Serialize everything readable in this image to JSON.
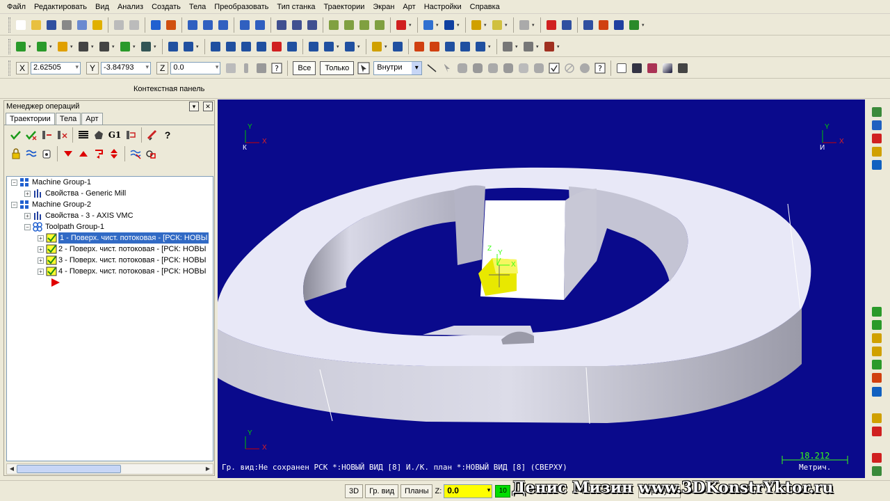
{
  "menu": [
    "Файл",
    "Редактировать",
    "Вид",
    "Анализ",
    "Создать",
    "Тела",
    "Преобразовать",
    "Тип станка",
    "Траектории",
    "Экран",
    "Арт",
    "Настройки",
    "Справка"
  ],
  "coords": {
    "x_label": "X",
    "x_value": "2.62505",
    "y_label": "Y",
    "y_value": "-3.84793",
    "z_label": "Z",
    "z_value": "0.0"
  },
  "selection": {
    "all_label": "Все",
    "only_label": "Только",
    "mode_value": "Внутри"
  },
  "context_panel_label": "Контекстная панель",
  "ops_manager": {
    "title": "Менеджер операций",
    "tabs": [
      "Траектории",
      "Тела",
      "Арт"
    ],
    "toolbar_text_g1": "G1",
    "tree": [
      {
        "text": "Machine Group-1",
        "level": 0,
        "icon": "machine-group-icon",
        "expander": "−"
      },
      {
        "text": "Свойства - Generic Mill",
        "level": 1,
        "icon": "properties-icon",
        "expander": "+"
      },
      {
        "text": "Machine Group-2",
        "level": 0,
        "icon": "machine-group-icon",
        "expander": "−"
      },
      {
        "text": "Свойства - 3 - AXIS VMC",
        "level": 1,
        "icon": "properties-icon",
        "expander": "+"
      },
      {
        "text": "Toolpath Group-1",
        "level": 1,
        "icon": "toolpath-group-icon",
        "expander": "−"
      },
      {
        "text": "1 - Поверх. чист. потоковая - [РСК: НОВЫ",
        "level": 2,
        "icon": "operation-check-icon",
        "expander": "+",
        "selected": true
      },
      {
        "text": "2 - Поверх. чист. потоковая - [РСК: НОВЫ",
        "level": 2,
        "icon": "operation-check-icon",
        "expander": "+"
      },
      {
        "text": "3 - Поверх. чист. потоковая - [РСК: НОВЫ",
        "level": 2,
        "icon": "operation-check-icon",
        "expander": "+"
      },
      {
        "text": "4 - Поверх. чист. потоковая - [РСК: НОВЫ",
        "level": 2,
        "icon": "operation-check-icon",
        "expander": "+"
      }
    ]
  },
  "viewport": {
    "background": "#0a0a8c",
    "status_text": "Гр. вид:Не сохранен  РСК *:НОВЫЙ ВИД [8]  И./К. план *:НОВЫЙ ВИД [8] (СВЕРХУ)",
    "scale_value": "18.212",
    "scale_unit": "Метрич.",
    "axis_top_left": {
      "x": "X",
      "y": "Y",
      "origin": "К"
    },
    "axis_top_right": {
      "x": "X",
      "y": "Y",
      "origin": "И"
    },
    "axis_bottom_left": {
      "x": "X",
      "y": "Y"
    },
    "axis_tool": {
      "x": "X",
      "y": "Y",
      "z": "Z"
    }
  },
  "statusbar": {
    "view_3d": "3D",
    "graphic_view": "Гр. вид",
    "planes": "Планы",
    "z_label": "Z:",
    "z_value": "0.0",
    "level_value": "10",
    "attributes": "Атрибуты"
  },
  "watermark": "Денис Мизин  www.3DKonstrYktor.ru",
  "colors": {
    "accent": "#316ac5",
    "part_top": "#e6e6f5",
    "part_side": "#b8b8c4",
    "tool_yellow": "#e8e800",
    "scale_green": "#39ff14"
  }
}
